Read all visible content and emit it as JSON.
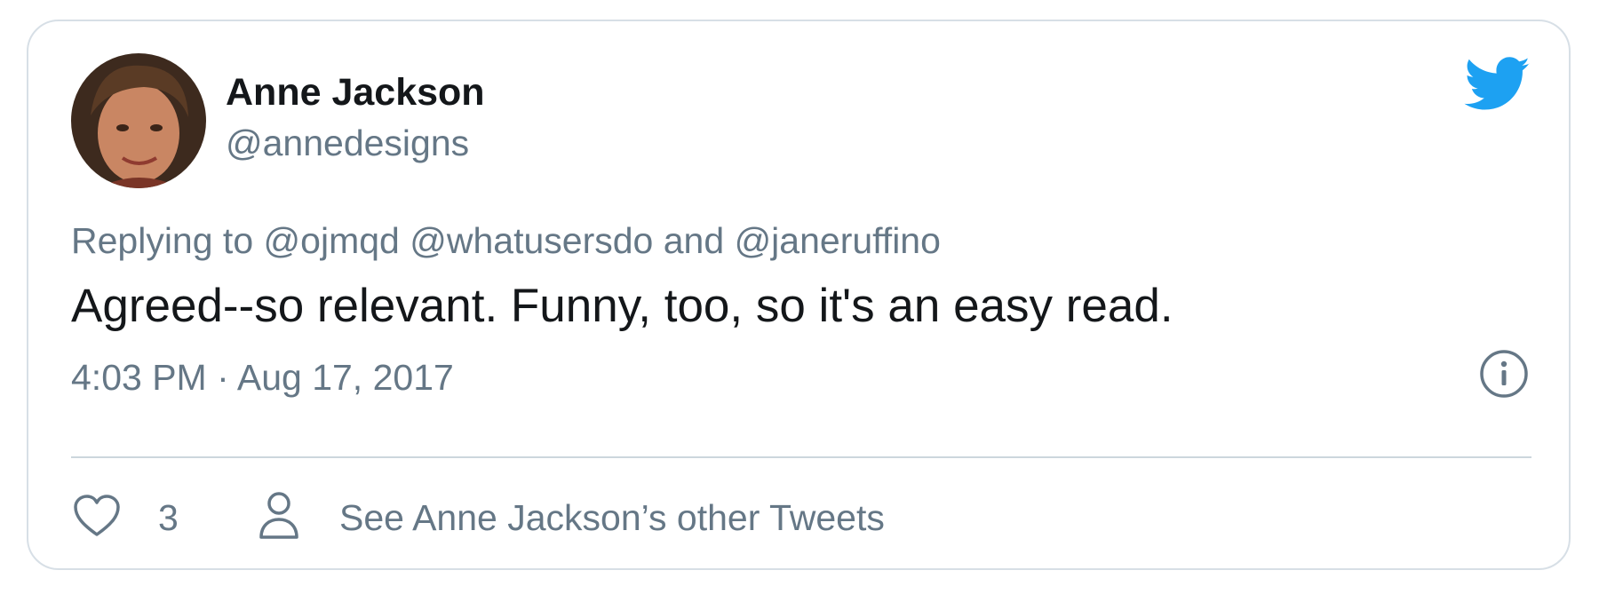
{
  "author": {
    "name": "Anne Jackson",
    "handle": "@annedesigns"
  },
  "reply": {
    "prefix": "Replying to",
    "mention_1": "@ojmqd",
    "mention_2": "@whatusersdo",
    "conjunction": "and",
    "mention_3": "@janeruffino"
  },
  "tweet": {
    "text": "Agreed--so relevant. Funny, too, so it's an easy read.",
    "timestamp": "4:03 PM · Aug 17, 2017"
  },
  "actions": {
    "like_count": "3",
    "other_tweets_label": "See Anne Jackson’s other Tweets"
  },
  "icons": {
    "brand": "twitter-bird-icon",
    "info": "info-icon",
    "like": "heart-icon",
    "profile": "person-icon"
  },
  "colors": {
    "brand_blue": "#1da1f2",
    "primary_text": "#14171a",
    "secondary_text": "#657786",
    "border": "#d7dfe6"
  }
}
